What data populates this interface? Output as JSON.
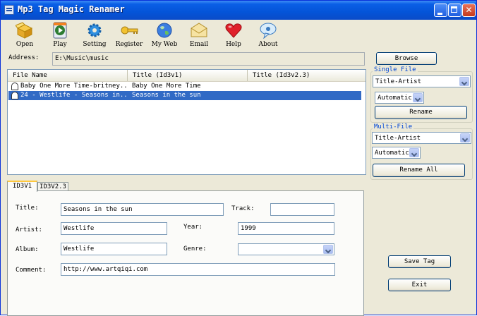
{
  "window": {
    "title": "Mp3 Tag Magic Renamer"
  },
  "toolbar": {
    "items": [
      {
        "label": "Open",
        "icon": "open-box-icon"
      },
      {
        "label": "Play",
        "icon": "play-icon"
      },
      {
        "label": "Setting",
        "icon": "gear-icon"
      },
      {
        "label": "Register",
        "icon": "key-icon"
      },
      {
        "label": "My Web",
        "icon": "globe-icon"
      },
      {
        "label": "Email",
        "icon": "envelope-icon"
      },
      {
        "label": "Help",
        "icon": "heart-icon"
      },
      {
        "label": "About",
        "icon": "speech-bubble-icon"
      }
    ]
  },
  "address": {
    "label": "Address:",
    "value": "E:\\Music\\music"
  },
  "browse_button": "Browse",
  "file_list": {
    "columns": [
      "File Name",
      "Title (Id3v1)",
      "Title (Id3v2.3)"
    ],
    "rows": [
      {
        "file_name": "Baby One More Time-britney...",
        "title_v1": "Baby One More Time",
        "title_v2": "",
        "selected": false
      },
      {
        "file_name": "24 - Westlife - Seasons in...",
        "title_v1": "Seasons in the sun",
        "title_v2": "",
        "selected": true
      }
    ]
  },
  "single_file": {
    "title": "Single File",
    "format": "Title-Artist",
    "case": "Automatic",
    "rename_button": "Rename"
  },
  "multi_file": {
    "title": "Multi-File",
    "format": "Title-Artist",
    "case": "Automatic",
    "rename_all_button": "Rename All"
  },
  "tabs": {
    "active": "ID3V1",
    "inactive": "ID3V2.3"
  },
  "tag": {
    "title_label": "Title:",
    "title": "Seasons in the sun",
    "track_label": "Track:",
    "track": "",
    "artist_label": "Artist:",
    "artist": "Westlife",
    "year_label": "Year:",
    "year": "1999",
    "album_label": "Album:",
    "album": "Westlife",
    "genre_label": "Genre:",
    "genre": "",
    "comment_label": "Comment:",
    "comment": "http://www.artqiqi.com"
  },
  "save_tag_button": "Save Tag",
  "exit_button": "Exit",
  "colors": {
    "title_bar": "#0454d8",
    "selection": "#316ac5",
    "face": "#ece9d8",
    "group_title": "#0046d5"
  }
}
